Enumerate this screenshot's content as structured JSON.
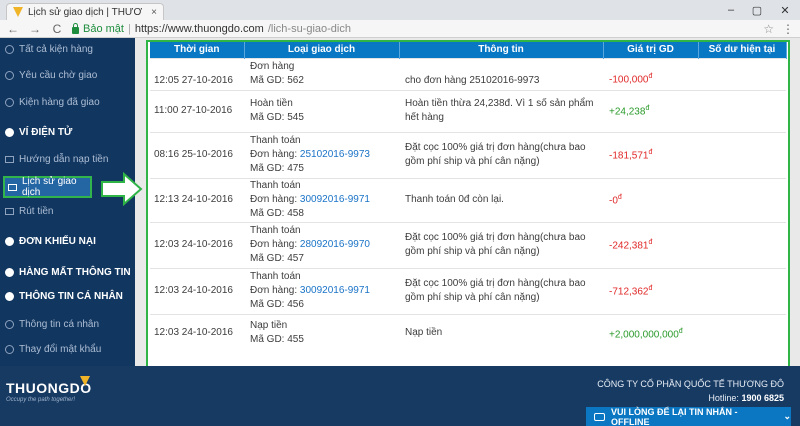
{
  "browser": {
    "tab_title": "Lịch sử giao dịch | THƯƠ",
    "tab_close": "×",
    "back": "←",
    "forward": "→",
    "reload": "C",
    "secure_label": "Bảo mật",
    "separator": "|",
    "url_domain": "https://www.thuongdo.com",
    "url_path": "/lich-su-giao-dich",
    "star": "☆",
    "menu": "⋮",
    "win_min": "–",
    "win_max": "▢",
    "win_close": "✕"
  },
  "sidebar": {
    "items": [
      {
        "label": "Tất cả kiện hàng"
      },
      {
        "label": "Yêu cầu chờ giao"
      },
      {
        "label": "Kiện hàng đã giao"
      },
      {
        "label": "VÍ ĐIỆN TỬ"
      },
      {
        "label": "Hướng dẫn nạp tiền"
      },
      {
        "label": "Lịch sử giao dịch"
      },
      {
        "label": "Rút tiền"
      },
      {
        "label": "ĐƠN KHIẾU NẠI"
      },
      {
        "label": "HÀNG MẤT THÔNG TIN"
      },
      {
        "label": "THÔNG TIN CÁ NHÂN"
      },
      {
        "label": "Thông tin cá nhân"
      },
      {
        "label": "Thay đổi mật khẩu"
      }
    ]
  },
  "table": {
    "headers": [
      "Thời gian",
      "Loại giao dịch",
      "Thông tin",
      "Giá trị GD",
      "Số dư hiện tại"
    ],
    "rows": [
      {
        "time": "12:05 27-10-2016",
        "type": "Đơn hàng",
        "order_label": "",
        "order": "",
        "txn": "Mã GD: 562",
        "info": "cho đơn hàng 25102016-9973",
        "value": "-100,000",
        "currency": "đ",
        "balance": ""
      },
      {
        "time": "11:00 27-10-2016",
        "type": "Hoàn tiền",
        "order_label": "",
        "order": "",
        "txn": "Mã GD: 545",
        "info": "Hoàn tiền thừa 24,238đ. Vì 1 số sản phẩm hết hàng",
        "value": "+24,238",
        "currency": "đ",
        "balance": ""
      },
      {
        "time": "08:16 25-10-2016",
        "type": "Thanh toán",
        "order_label": "Đơn hàng: ",
        "order": "25102016-9973",
        "txn": "Mã GD: 475",
        "info": "Đặt cọc 100% giá trị đơn hàng(chưa bao gồm phí ship và phí cân nặng)",
        "value": "-181,571",
        "currency": "đ",
        "balance": ""
      },
      {
        "time": "12:13 24-10-2016",
        "type": "Thanh toán",
        "order_label": "Đơn hàng: ",
        "order": "30092016-9971",
        "txn": "Mã GD: 458",
        "info": "Thanh toán 0đ còn lại.",
        "value": "-0",
        "currency": "đ",
        "balance": ""
      },
      {
        "time": "12:03 24-10-2016",
        "type": "Thanh toán",
        "order_label": "Đơn hàng: ",
        "order": "28092016-9970",
        "txn": "Mã GD: 457",
        "info": "Đặt cọc 100% giá trị đơn hàng(chưa bao gồm phí ship và phí cân nặng)",
        "value": "-242,381",
        "currency": "đ",
        "balance": ""
      },
      {
        "time": "12:03 24-10-2016",
        "type": "Thanh toán",
        "order_label": "Đơn hàng: ",
        "order": "30092016-9971",
        "txn": "Mã GD: 456",
        "info": "Đặt cọc 100% giá trị đơn hàng(chưa bao gồm phí ship và phí cân nặng)",
        "value": "-712,362",
        "currency": "đ",
        "balance": ""
      },
      {
        "time": "12:03 24-10-2016",
        "type": "Nạp tiền",
        "order_label": "",
        "order": "",
        "txn": "Mã GD: 455",
        "info": "Nạp tiền",
        "value": "+2,000,000,000",
        "currency": "đ",
        "balance": ""
      }
    ]
  },
  "footer": {
    "logo_text": "THUONGDO",
    "tagline": "Occupy the path together!",
    "company": "CÔNG TY CỔ PHẦN QUỐC TẾ THƯƠNG ĐÔ",
    "hotline_label": "Hotline: ",
    "hotline": "1900 6825",
    "chat_label": "VUI LÒNG ĐỂ LẠI TIN NHẮN - OFFLINE",
    "chat_toggle": "⌄"
  },
  "colors": {
    "sidebar_bg": "#113660",
    "header_bg": "#0877c4",
    "highlight": "#2fb446",
    "negative": "#e12828",
    "positive": "#2a9a2a",
    "link": "#1a73c7"
  }
}
